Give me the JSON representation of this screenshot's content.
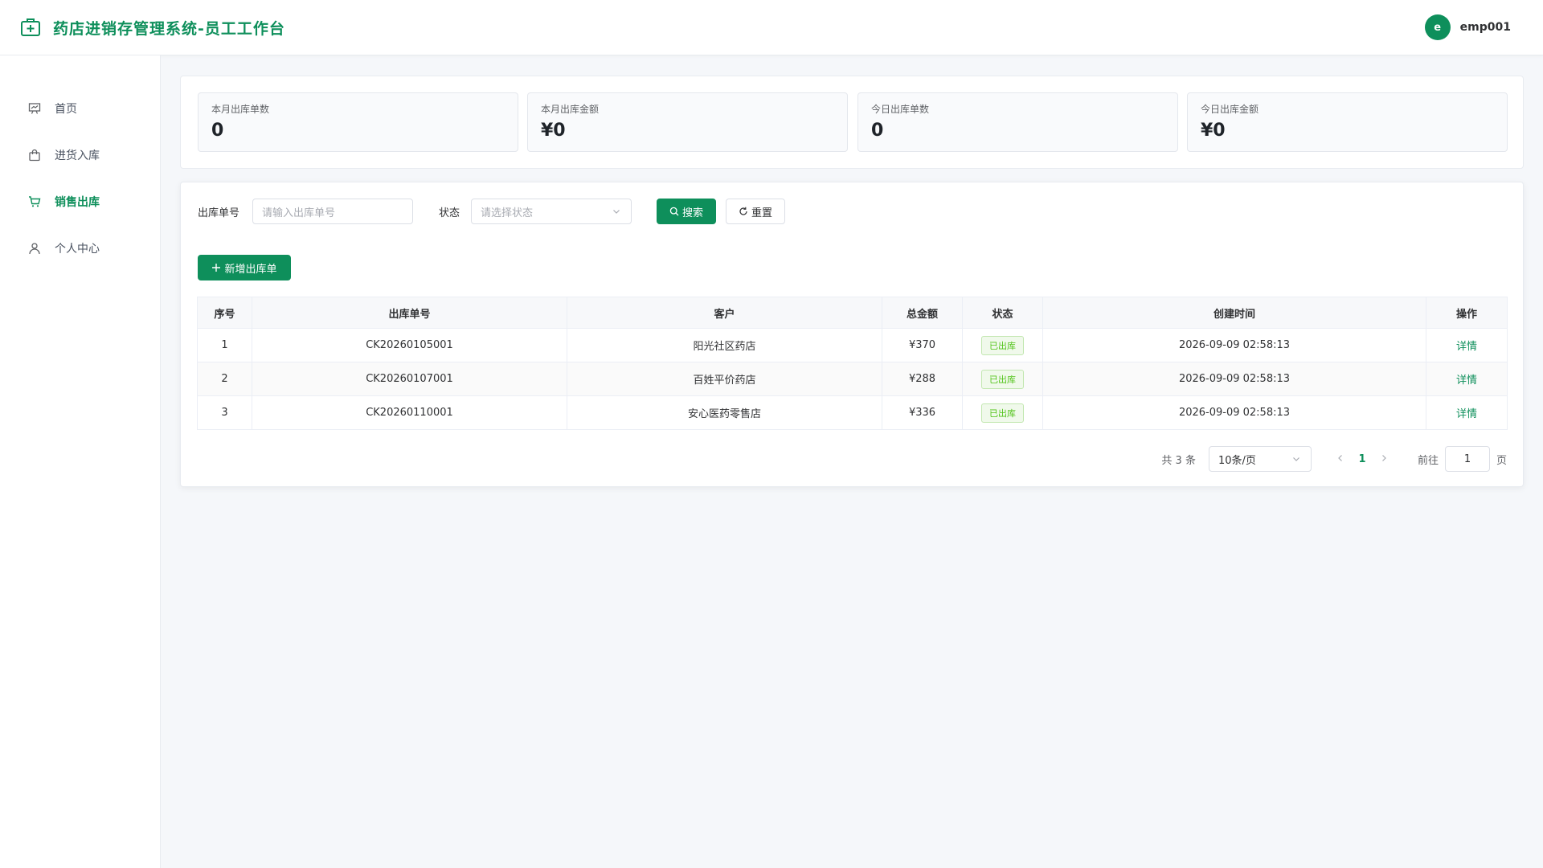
{
  "app": {
    "title": "药店进销存管理系统-员工工作台",
    "brand_color": "#0e8f5b"
  },
  "user": {
    "avatar_letter": "e",
    "name": "emp001"
  },
  "sidebar": {
    "items": [
      {
        "label": "首页",
        "icon": "presentation-icon",
        "active": false
      },
      {
        "label": "进货入库",
        "icon": "shopping-bag-icon",
        "active": false
      },
      {
        "label": "销售出库",
        "icon": "cart-icon",
        "active": true
      },
      {
        "label": "个人中心",
        "icon": "user-icon",
        "active": false
      }
    ]
  },
  "stats": [
    {
      "label": "本月出库单数",
      "value": "0"
    },
    {
      "label": "本月出库金额",
      "value": "¥0"
    },
    {
      "label": "今日出库单数",
      "value": "0"
    },
    {
      "label": "今日出库金额",
      "value": "¥0"
    }
  ],
  "search": {
    "order_no_label": "出库单号",
    "order_no_placeholder": "请输入出库单号",
    "status_label": "状态",
    "status_placeholder": "请选择状态",
    "search_button": "搜索",
    "reset_button": "重置"
  },
  "toolbar": {
    "add_button": "新增出库单"
  },
  "table": {
    "headers": [
      "序号",
      "出库单号",
      "客户",
      "总金额",
      "状态",
      "创建时间",
      "操作"
    ],
    "rows": [
      {
        "index": "1",
        "order_no": "CK20260105001",
        "customer": "阳光社区药店",
        "amount": "¥370",
        "status": "已出库",
        "created": "2026-09-09 02:58:13",
        "action": "详情"
      },
      {
        "index": "2",
        "order_no": "CK20260107001",
        "customer": "百姓平价药店",
        "amount": "¥288",
        "status": "已出库",
        "created": "2026-09-09 02:58:13",
        "action": "详情"
      },
      {
        "index": "3",
        "order_no": "CK20260110001",
        "customer": "安心医药零售店",
        "amount": "¥336",
        "status": "已出库",
        "created": "2026-09-09 02:58:13",
        "action": "详情"
      }
    ]
  },
  "pagination": {
    "total": "共 3 条",
    "page_size": "10条/页",
    "current_page": "1",
    "goto_label": "前往",
    "goto_value": "1",
    "page_suffix": "页"
  }
}
